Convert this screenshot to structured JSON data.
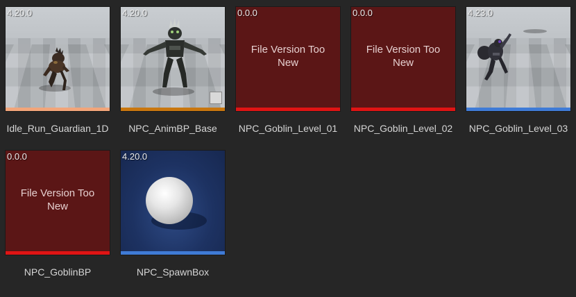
{
  "assets": [
    {
      "name": "Idle_Run_Guardian_1D",
      "version": "4.20.0",
      "thumb": "guardian-run",
      "bar_color": "#f2a57a",
      "error": ""
    },
    {
      "name": "NPC_AnimBP_Base",
      "version": "4.20.0",
      "thumb": "goblin-tpose",
      "bar_color": "#c9770f",
      "error": ""
    },
    {
      "name": "NPC_Goblin_Level_01",
      "version": "0.0.0",
      "thumb": "error",
      "bar_color": "#e01414",
      "error": "File Version Too New"
    },
    {
      "name": "NPC_Goblin_Level_02",
      "version": "0.0.0",
      "thumb": "error",
      "bar_color": "#e01414",
      "error": "File Version Too New"
    },
    {
      "name": "NPC_Goblin_Level_03",
      "version": "4.23.0",
      "thumb": "goblin-jump",
      "bar_color": "#3f7bd6",
      "error": ""
    },
    {
      "name": "NPC_GoblinBP",
      "version": "0.0.0",
      "thumb": "error",
      "bar_color": "#e01414",
      "error": "File Version Too New"
    },
    {
      "name": "NPC_SpawnBox",
      "version": "4.20.0",
      "thumb": "sphere",
      "bar_color": "#3f7bd6",
      "error": ""
    }
  ]
}
